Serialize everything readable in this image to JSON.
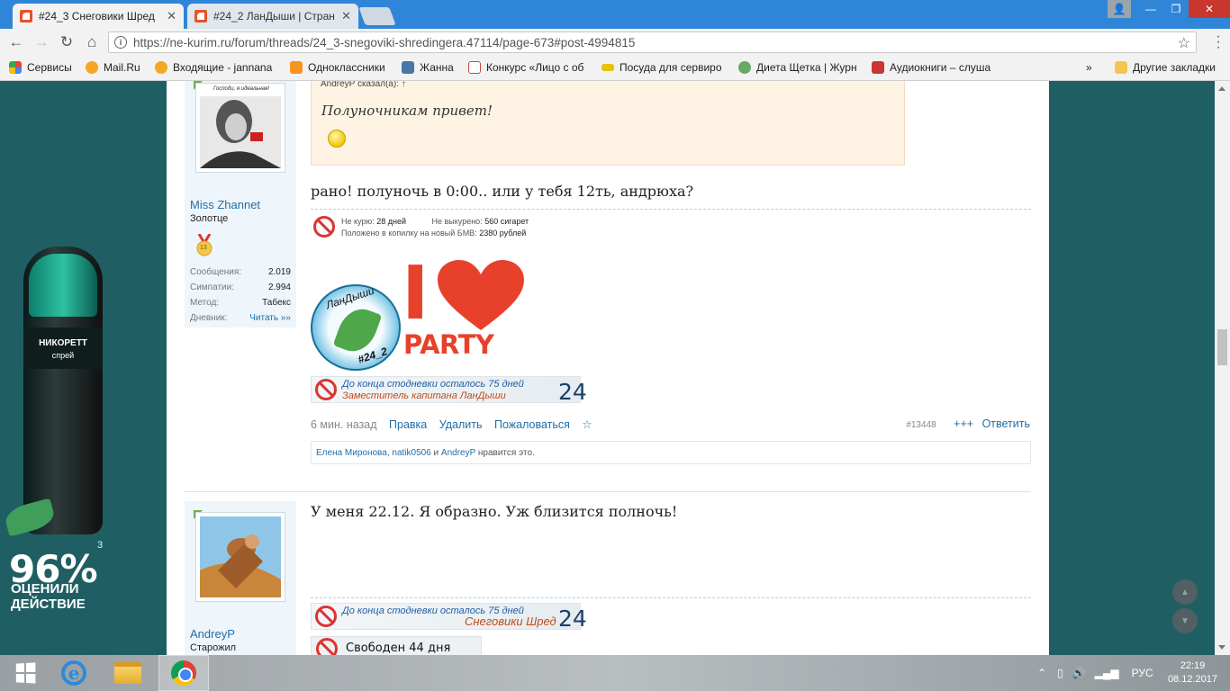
{
  "browser": {
    "tabs": [
      {
        "title": "#24_3 Снеговики Шред",
        "active": true
      },
      {
        "title": "#24_2 ЛанДыши | Стран",
        "active": false
      }
    ],
    "url": "https://ne-kurim.ru/forum/threads/24_3-snegoviki-shredingera.47114/page-673#post-4994815",
    "bookmarks": [
      {
        "label": "Сервисы",
        "color": "#e94235"
      },
      {
        "label": "Mail.Ru",
        "color": "#f5a623"
      },
      {
        "label": "Входящие - jannana",
        "color": "#f5a623"
      },
      {
        "label": "Одноклассники",
        "color": "#f7931e"
      },
      {
        "label": "Жанна",
        "color": "#4a76a8"
      },
      {
        "label": "Конкурс «Лицо с об",
        "color": "#d44"
      },
      {
        "label": "Посуда для сервиро",
        "color": "#e6c300"
      },
      {
        "label": "Диета Щетка | Журн",
        "color": "#6a6"
      },
      {
        "label": "Аудиокниги – слуша",
        "color": "#c33"
      }
    ],
    "bookmarks_more": "»",
    "other_bookmarks": "Другие закладки"
  },
  "ad": {
    "brand": "НИКОРЕТТ",
    "sub": "спрей",
    "percent": "96%",
    "sup": "3",
    "line1": "ОЦЕНИЛИ",
    "line2": "ДЕЙСТВИЕ"
  },
  "post1": {
    "avatar_caption": "Господи, я идеальная!",
    "username": "Miss Zhannet",
    "user_title": "Золотце",
    "badge": "13",
    "stats": [
      {
        "k": "Сообщения:",
        "v": "2.019"
      },
      {
        "k": "Симпатии:",
        "v": "2.994"
      },
      {
        "k": "Метод:",
        "v": "Табекс"
      },
      {
        "k": "Дневник:",
        "v": "Читать »»"
      }
    ],
    "quote_by": "AndreyP сказал(а): ↑",
    "quote_text": "Полуночникам привет!",
    "message": "рано! полуночь в 0:00.. или у тебя 12ть, андрюха?",
    "smoke": {
      "k1": "Не курю:",
      "v1": "28 дней",
      "k2": "Не выкурено:",
      "v2": "560 сигарет",
      "k3": "Положено в копилку на новый БМВ:",
      "v3": "2380 рублей"
    },
    "logo_top": "ЛанДыши",
    "logo_bottom": "#24_2",
    "party_i": "I",
    "party_word": "PARTY",
    "sig_line1": "До конца стодневки осталось 75 дней",
    "sig_line2": "Заместитель капитана ЛанДыши",
    "sig_num": "24",
    "time": "6 мин. назад",
    "actions": [
      "Правка",
      "Удалить",
      "Пожаловаться",
      "☆"
    ],
    "post_id": "#13448",
    "plus": "+++",
    "reply": "Ответить",
    "likes": {
      "u1": "Елена Миронова",
      "sep1": ", ",
      "u2": "natik0506",
      "and": " и ",
      "u3": "AndreyP",
      "tail": " нравится это."
    }
  },
  "post2": {
    "username": "AndreyP",
    "user_title": "Старожил",
    "message": "У меня 22.12. Я образно. Уж близится полночь!",
    "sig_line1": "До конца стодневки осталось 75 дней",
    "sig_line2": "Снеговики Шред",
    "sig_num": "24",
    "free_text": "Свободен 44 дня"
  },
  "taskbar": {
    "lang": "РУС",
    "time": "22:19",
    "date": "08.12.2017"
  }
}
